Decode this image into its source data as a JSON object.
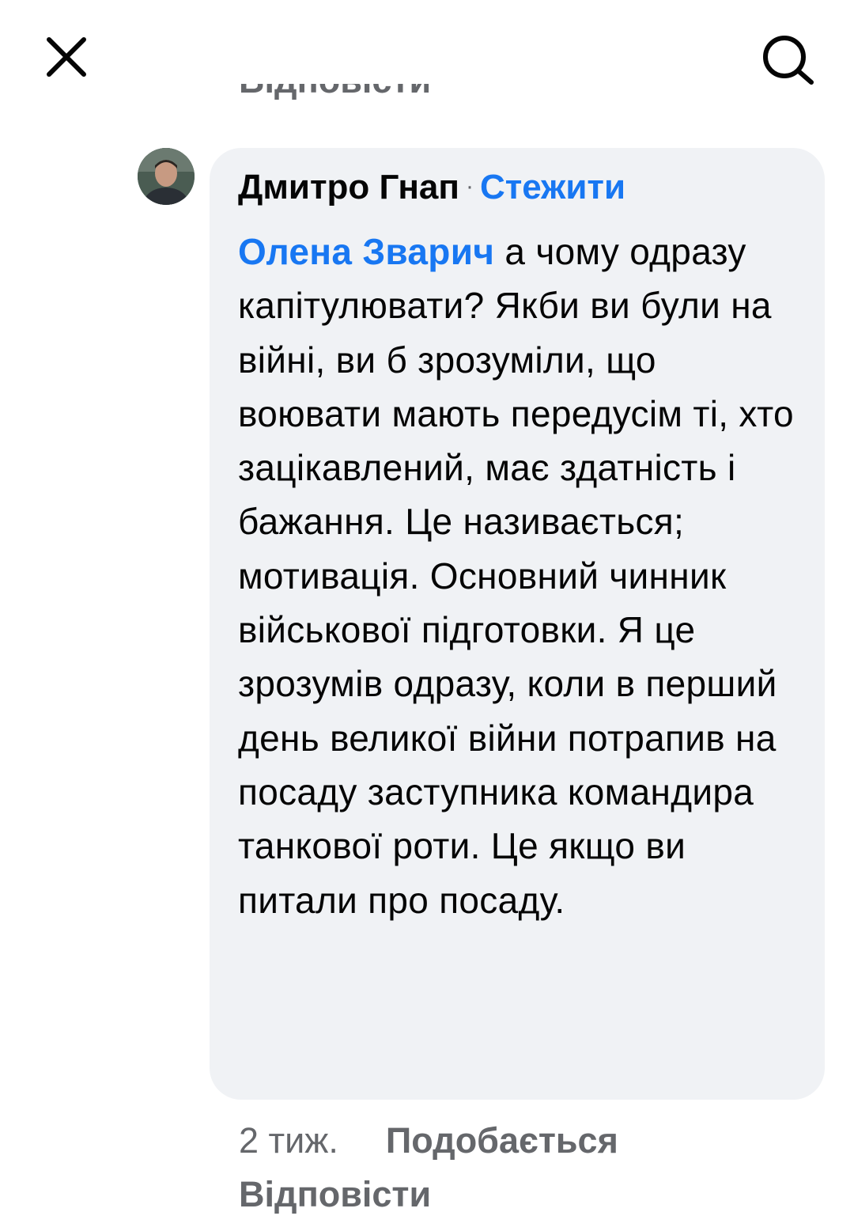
{
  "toolbar": {
    "close_icon": "close-icon",
    "search_icon": "search-icon"
  },
  "previous_comment": {
    "reply_label": "Відповісти"
  },
  "comment": {
    "author": "Дмитро Гнап",
    "separator": "·",
    "follow_label": "Стежити",
    "mention": "Олена Зварич",
    "text": " а чому одразу капітулювати? Якби ви були на війні, ви б зрозуміли, що воювати мають передусім ті, хто зацікавлений, має здатність і бажання. Це називається; мотивація. Основний чинник військової підготовки. Я це зрозумів одразу, коли в перший день великої війни потрапив на посаду заступника командира танкової роти. Це якщо ви питали про посаду.",
    "time": "2 тиж.",
    "like_label": "Подобається",
    "reply_label": "Відповісти"
  },
  "colors": {
    "link_blue": "#1877f2",
    "bubble_bg": "#f0f2f5",
    "secondary_text": "#65676b",
    "primary_text": "#050505"
  }
}
